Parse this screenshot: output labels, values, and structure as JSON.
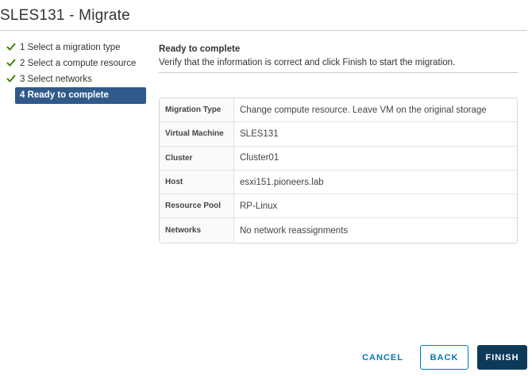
{
  "dialog": {
    "title": "SLES131 - Migrate"
  },
  "steps": [
    {
      "label": "1 Select a migration type",
      "status": "complete",
      "icon": "check-icon"
    },
    {
      "label": "2 Select a compute resource",
      "status": "complete",
      "icon": "check-icon"
    },
    {
      "label": "3 Select networks",
      "status": "complete",
      "icon": "check-icon"
    },
    {
      "label": "4 Ready to complete",
      "status": "active"
    }
  ],
  "content": {
    "heading": "Ready to complete",
    "description": "Verify that the information is correct and click Finish to start the migration."
  },
  "summary": [
    {
      "key": "Migration Type",
      "value": "Change compute resource. Leave VM on the original storage"
    },
    {
      "key": "Virtual Machine",
      "value": "SLES131"
    },
    {
      "key": "Cluster",
      "value": "Cluster01"
    },
    {
      "key": "Host",
      "value": "esxi151.pioneers.lab"
    },
    {
      "key": "Resource Pool",
      "value": "RP-Linux"
    },
    {
      "key": "Networks",
      "value": "No network reassignments"
    }
  ],
  "buttons": {
    "cancel": "CANCEL",
    "back": "BACK",
    "finish": "FINISH"
  },
  "colors": {
    "check": "#3c8500",
    "active_step": "#2f5a8a",
    "primary": "#0e3a5a",
    "link": "#0079b8"
  }
}
